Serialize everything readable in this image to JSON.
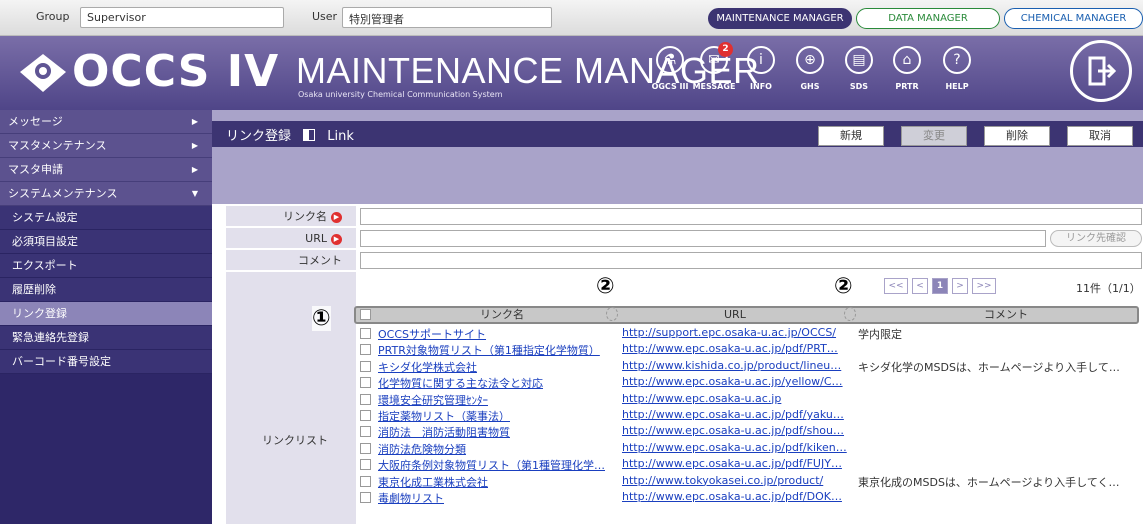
{
  "topbar": {
    "group_label": "Group",
    "group_value": "Supervisor",
    "user_label": "User",
    "user_value": "特別管理者",
    "managers": [
      "MAINTENANCE MANAGER",
      "DATA MANAGER",
      "CHEMICAL MANAGER"
    ]
  },
  "header": {
    "logo": "OCCS IV",
    "title": "MAINTENANCE MANAGER",
    "subtitle": "Osaka university Chemical Communication System",
    "icons": [
      {
        "label": "OGCS III",
        "icon": "flask-icon"
      },
      {
        "label": "MESSAGE",
        "icon": "mail-icon",
        "badge": "2"
      },
      {
        "label": "INFO",
        "icon": "info-icon"
      },
      {
        "label": "GHS",
        "icon": "globe-icon"
      },
      {
        "label": "SDS",
        "icon": "document-icon"
      },
      {
        "label": "PRTR",
        "icon": "factory-icon"
      },
      {
        "label": "HELP",
        "icon": "help-icon"
      }
    ]
  },
  "sidebar": {
    "main_items": [
      {
        "label": "メッセージ",
        "arrow": "▶"
      },
      {
        "label": "マスタメンテナンス",
        "arrow": "▶"
      },
      {
        "label": "マスタ申請",
        "arrow": "▶"
      },
      {
        "label": "システムメンテナンス",
        "arrow": "▼"
      }
    ],
    "sub_items": [
      "システム設定",
      "必須項目設定",
      "エクスポート",
      "履歴削除",
      "リンク登録",
      "緊急連絡先登録",
      "バーコード番号設定"
    ],
    "active": "リンク登録"
  },
  "page": {
    "title": "リンク登録",
    "title_en": "Link",
    "buttons": [
      "新規",
      "変更",
      "削除",
      "取消"
    ]
  },
  "form": {
    "link_name_label": "リンク名",
    "url_label": "URL",
    "comment_label": "コメント",
    "check_button": "リンク先確認",
    "list_label": "リンクリスト"
  },
  "pager": {
    "first": "<<",
    "prev": "<",
    "current": "1",
    "next": ">",
    "last": ">>",
    "count": "11件（1/1）"
  },
  "table": {
    "headers": [
      "リンク名",
      "URL",
      "コメント"
    ],
    "rows": [
      {
        "name": "OCCSサポートサイト",
        "url": "http://support.epc.osaka-u.ac.jp/OCCS/",
        "comment": "学内限定"
      },
      {
        "name": "PRTR対象物質リスト（第1種指定化学物質）",
        "url": "http://www.epc.osaka-u.ac.jp/pdf/PRT…",
        "comment": ""
      },
      {
        "name": "キシダ化学株式会社",
        "url": "http://www.kishida.co.jp/product/lineu…",
        "comment": "キシダ化学のMSDSは、ホームページより入手して…"
      },
      {
        "name": "化学物質に関する主な法令と対応",
        "url": "http://www.epc.osaka-u.ac.jp/yellow/C…",
        "comment": ""
      },
      {
        "name": "環境安全研究管理ｾﾝﾀｰ",
        "url": "http://www.epc.osaka-u.ac.jp",
        "comment": ""
      },
      {
        "name": "指定薬物リスト（薬事法）",
        "url": "http://www.epc.osaka-u.ac.jp/pdf/yaku…",
        "comment": ""
      },
      {
        "name": "消防法　消防活動阻害物質",
        "url": "http://www.epc.osaka-u.ac.jp/pdf/shou…",
        "comment": ""
      },
      {
        "name": "消防法危険物分類",
        "url": "http://www.epc.osaka-u.ac.jp/pdf/kiken…",
        "comment": ""
      },
      {
        "name": "大阪府条例対象物質リスト（第1種管理化学…",
        "url": "http://www.epc.osaka-u.ac.jp/pdf/FUJY…",
        "comment": ""
      },
      {
        "name": "東京化成工業株式会社",
        "url": "http://www.tokyokasei.co.jp/product/",
        "comment": "東京化成のMSDSは、ホームページより入手してく…"
      },
      {
        "name": "毒劇物リスト",
        "url": "http://www.epc.osaka-u.ac.jp/pdf/DOK…",
        "comment": ""
      }
    ]
  },
  "markers": [
    "①",
    "②",
    "②"
  ]
}
